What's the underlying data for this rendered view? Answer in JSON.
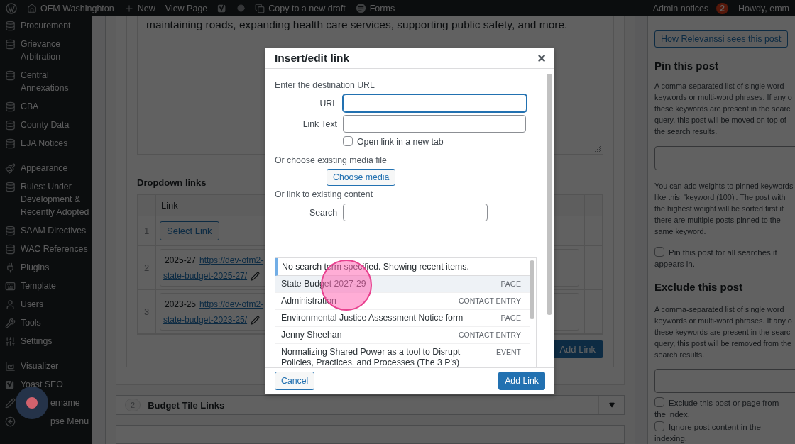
{
  "top_bar": {
    "site_name": "OFM Washinghton",
    "new_label": "New",
    "view_page": "View Page",
    "copy_label": "Copy to a new draft",
    "forms_label": "Forms",
    "admin_notices": "Admin notices",
    "notice_count": "2",
    "howdy": "Howdy, emm"
  },
  "sidebar": {
    "groups": [
      [
        {
          "label": "Procurement",
          "kind": "database"
        },
        {
          "label": "Grievance Arbitration",
          "kind": "database"
        },
        {
          "label": "Central Annexations",
          "kind": "database"
        },
        {
          "label": "CBA",
          "kind": "database"
        },
        {
          "label": "County Data",
          "kind": "database"
        },
        {
          "label": "EJA Notices",
          "kind": "database"
        }
      ],
      [
        {
          "label": "Appearance",
          "kind": "brush"
        },
        {
          "label": "Rules: Under Development & Recently Adopted",
          "kind": "database"
        },
        {
          "label": "SAAM Directives",
          "kind": "database"
        },
        {
          "label": "WAC References",
          "kind": "database"
        },
        {
          "label": "Plugins",
          "kind": "plug"
        },
        {
          "label": "Template",
          "kind": "keyboard"
        },
        {
          "label": "Users",
          "kind": "user"
        },
        {
          "label": "Tools",
          "kind": "wrench"
        },
        {
          "label": "Settings",
          "kind": "settings"
        }
      ],
      [
        {
          "label": "Visualizer",
          "kind": "chart"
        },
        {
          "label": "Yoast SEO",
          "kind": "yoast"
        },
        {
          "label": "ername",
          "kind": "pencil"
        },
        {
          "label": "pse Menu",
          "kind": "collapse"
        }
      ]
    ]
  },
  "editor": {
    "text": "maintaining roads, expanding health care services, supporting public safety, and more."
  },
  "dropdown_links": {
    "title": "Dropdown links",
    "column": "Link",
    "rows": [
      {
        "number": "1",
        "kind": "button",
        "button": "Select Link"
      },
      {
        "number": "2",
        "kind": "link",
        "year": "2025-27",
        "url": "https://dev-ofm2-",
        "url_line2": "state-budget-2025-27/"
      },
      {
        "number": "3",
        "kind": "link",
        "year": "2023-25",
        "url": "https://dev-ofm2-",
        "url_line2": "state-budget-2023-25/"
      }
    ],
    "add_button": "Add Link"
  },
  "budget_tiles": {
    "number": "2",
    "title": "Budget Tile Links"
  },
  "relevanssi": {
    "button": "How Relevanssi sees this post",
    "pin_title": "Pin this post",
    "pin_help": [
      "A comma-separated list of single word",
      "keywords or multi-word phrases. If any o",
      "these keywords are present in the searc",
      "query, this post will be moved on top of",
      "the search results."
    ],
    "weights_help": [
      "You can add weights to pinned keywords",
      "like this: 'keyword (100)'. The post with",
      "the highest weight will be sorted first if",
      "there are multiple posts pinned to the",
      "same keyword."
    ],
    "pin_all": {
      "label": "Pin this post for all searches it appears in.",
      "checked": false
    },
    "exclude_title": "Exclude this post",
    "exclude_help": [
      "A comma-separated list of single word",
      "keywords or multi-word phrases. If any o",
      "these keywords are present in the searc",
      "query, this post will be removed from the",
      "search results."
    ],
    "exclude_check": {
      "label": "Exclude this post or page from the index.",
      "checked": false
    },
    "ignore_check": {
      "label": "Ignore post content in the indexing.",
      "checked": false
    }
  },
  "dialog": {
    "title": "Insert/edit link",
    "close": "×",
    "intro": "Enter the destination URL",
    "url_label": "URL",
    "link_text_label": "Link Text",
    "new_tab": {
      "label": "Open link in a new tab",
      "checked": false
    },
    "media_label": "Or choose existing media file",
    "media_button": "Choose media",
    "existing_label": "Or link to existing content",
    "search_label": "Search",
    "notice": "No search term specified. Showing recent items.",
    "results": [
      {
        "title": "State Budget 2027-29",
        "type": "PAGE",
        "selected": true
      },
      {
        "title": "Administration",
        "type": "CONTACT ENTRY",
        "selected": false
      },
      {
        "title": "Environmental Justice Assessment Notice form",
        "type": "PAGE",
        "selected": false
      },
      {
        "title": "Jenny Sheehan",
        "type": "CONTACT ENTRY",
        "selected": false
      },
      {
        "title": "Normalizing Shared Power as a tool to Disrupt Policies, Practices, and Processes (The 3 P's)",
        "type": "EVENT",
        "selected": false
      }
    ],
    "cancel": "Cancel",
    "submit": "Add Link"
  }
}
